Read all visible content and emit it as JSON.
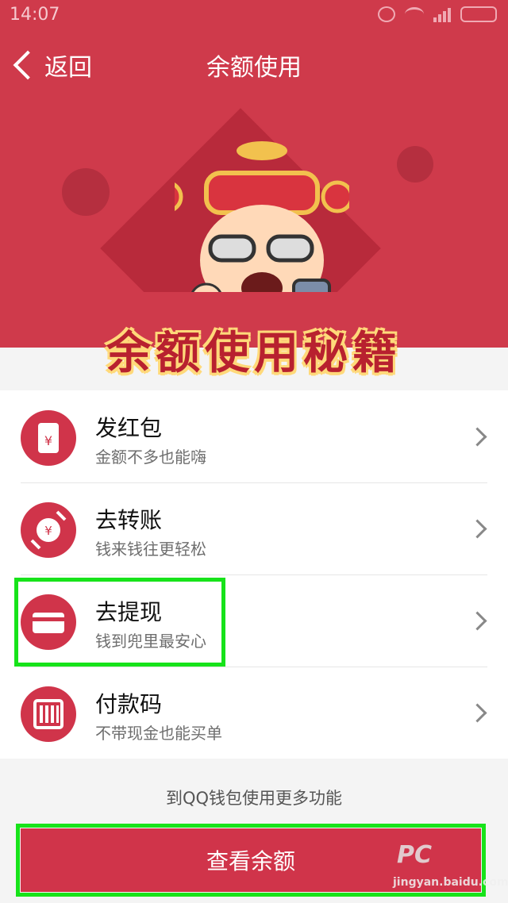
{
  "status_bar": {
    "time": "14:07"
  },
  "nav": {
    "back_label": "返回",
    "title": "余额使用"
  },
  "banner": {
    "text": "余额使用秘籍"
  },
  "menu": [
    {
      "title": "发红包",
      "subtitle": "金额不多也能嗨",
      "icon": "cup-yuan-icon"
    },
    {
      "title": "去转账",
      "subtitle": "钱来钱往更轻松",
      "icon": "transfer-icon"
    },
    {
      "title": "去提现",
      "subtitle": "钱到兜里最安心",
      "icon": "card-icon"
    },
    {
      "title": "付款码",
      "subtitle": "不带现金也能买单",
      "icon": "barcode-icon"
    }
  ],
  "more_link": "到QQ钱包使用更多功能",
  "bottom_button": "查看余额",
  "colors": {
    "primary": "#cf3a4b",
    "highlight": "#17e31a"
  }
}
